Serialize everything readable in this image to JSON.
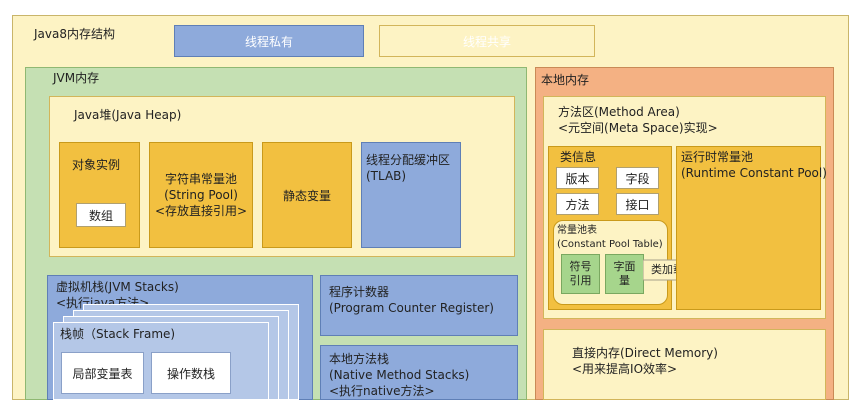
{
  "title": "Java8内存结构",
  "legend": {
    "thread_private": "线程私有",
    "thread_shared": "线程共享"
  },
  "jvm": {
    "title": "JVM内存",
    "heap": {
      "title": "Java堆(Java Heap)",
      "object_instance": "对象实例",
      "array": "数组",
      "string_pool": "字符串常量池\n(String Pool)\n<存放直接引用>",
      "static_vars": "静态变量",
      "tlab": "线程分配缓冲区\n(TLAB)"
    },
    "vm_stacks": {
      "title": "虚拟机栈(JVM Stacks)\n<执行java方法>",
      "frame_title": "栈帧（Stack Frame)",
      "local_vars": "局部变量表",
      "operand_stack": "操作数栈"
    },
    "pc_register": "程序计数器\n(Program Counter Register)",
    "native_stacks": "本地方法栈\n(Native Method Stacks)\n<执行native方法>"
  },
  "native_memory": {
    "title": "本地内存",
    "method_area": {
      "title": "方法区(Method Area)\n<元空间(Meta Space)实现>",
      "class_info": "类信息",
      "version": "版本",
      "field": "字段",
      "method": "方法",
      "interface": "接口",
      "constant_pool_table": "常量池表\n(Constant Pool Table)",
      "symbol_ref": "符号\n引用",
      "literal": "字面\n量",
      "after_load": "类加载后",
      "runtime_constant_pool": "运行时常量池\n(Runtime Constant Pool)"
    },
    "direct_memory": "直接内存(Direct Memory)\n<用来提高IO效率>"
  },
  "colors": {
    "outer_bg": "#fdf3c4",
    "jvm_bg": "#c5e0b3",
    "native_bg": "#f4b183",
    "private_blue": "#8eaadb",
    "shared_yellow": "#f2c040"
  }
}
